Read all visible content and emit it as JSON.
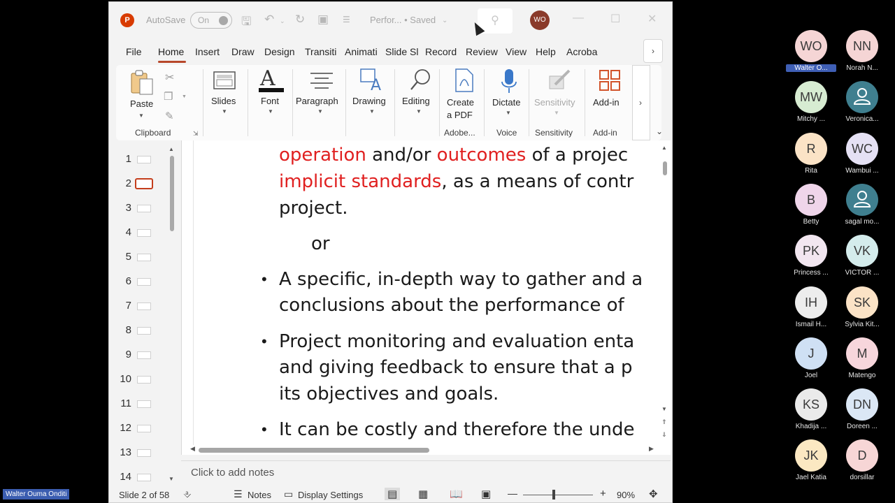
{
  "titlebar": {
    "autosave_label": "AutoSave",
    "autosave_state": "On",
    "doc_title": "Perfor... • Saved",
    "user_initials": "WO"
  },
  "tabs": [
    "File",
    "Home",
    "Insert",
    "Draw",
    "Design",
    "Transiti",
    "Animati",
    "Slide Sl",
    "Record",
    "Review",
    "View",
    "Help",
    "Acroba"
  ],
  "active_tab": "Home",
  "ribbon": {
    "paste": "Paste",
    "clipboard": "Clipboard",
    "slides": "Slides",
    "font": "Font",
    "paragraph": "Paragraph",
    "drawing": "Drawing",
    "editing": "Editing",
    "create_pdf_1": "Create",
    "create_pdf_2": "a PDF",
    "adobe": "Adobe...",
    "dictate": "Dictate",
    "voice": "Voice",
    "sensitivity_btn": "Sensitivity",
    "sensitivity": "Sensitivity",
    "addin_btn": "Add-in",
    "addin": "Add-in"
  },
  "thumbnails": [
    "1",
    "2",
    "3",
    "4",
    "5",
    "6",
    "7",
    "8",
    "9",
    "10",
    "11",
    "12",
    "13",
    "14"
  ],
  "selected_slide": "2",
  "slide": {
    "l1_a": "operation",
    "l1_b": " and/or ",
    "l1_c": "outcomes",
    "l1_d": " of a projec",
    "l2_a": "implicit standards",
    "l2_b": ", as a means of contr",
    "l3": "project.",
    "or": "or",
    "b1_l1": "A specific, in-depth way to gather and a",
    "b1_l2": "conclusions about the performance of",
    "b2_l1": "Project monitoring and evaluation enta",
    "b2_l2": "and giving  feedback to ensure that a p",
    "b2_l3": "its objectives and goals.",
    "b3_l1": "It can be costly and therefore the unde"
  },
  "notes_placeholder": "Click to add notes",
  "status": {
    "slide_of": "Slide 2 of 58",
    "notes": "Notes",
    "display_settings": "Display Settings",
    "zoom": "90%"
  },
  "participants": [
    {
      "initials": "WO",
      "name": "Walter O...",
      "color": "#f5d5d5",
      "highlight": true
    },
    {
      "initials": "NN",
      "name": "Norah N...",
      "color": "#f5d5d5"
    },
    {
      "initials": "MW",
      "name": "Mitchy ...",
      "color": "#d7ecd2"
    },
    {
      "initials": "",
      "name": "Veronica...",
      "color": "#3f7f8f",
      "icon": "person-icon"
    },
    {
      "initials": "R",
      "name": "Rita",
      "color": "#fbe3c6"
    },
    {
      "initials": "WC",
      "name": "Wambui ...",
      "color": "#e5e1f4"
    },
    {
      "initials": "B",
      "name": "Betty",
      "color": "#efd5ea"
    },
    {
      "initials": "",
      "name": "sagal mo...",
      "color": "#3f7f8f",
      "icon": "person-icon"
    },
    {
      "initials": "PK",
      "name": "Princess ...",
      "color": "#f2e6f0"
    },
    {
      "initials": "VK",
      "name": "VICTOR ...",
      "color": "#d4ecec"
    },
    {
      "initials": "IH",
      "name": "Ismail H...",
      "color": "#ededed"
    },
    {
      "initials": "SK",
      "name": "Sylvia Kit...",
      "color": "#fbe3c6"
    },
    {
      "initials": "J",
      "name": "Joel",
      "color": "#cfe0f4"
    },
    {
      "initials": "M",
      "name": "Matengo",
      "color": "#f7d6dc"
    },
    {
      "initials": "KS",
      "name": "Khadija ...",
      "color": "#eaeaea"
    },
    {
      "initials": "DN",
      "name": "Doreen ...",
      "color": "#dbe7f5"
    },
    {
      "initials": "JK",
      "name": "Jael Katia",
      "color": "#fbe8c2"
    },
    {
      "initials": "D",
      "name": "dorsillar",
      "color": "#f7d6d6"
    }
  ],
  "presenter_name": "Walter Ouma Onditi"
}
